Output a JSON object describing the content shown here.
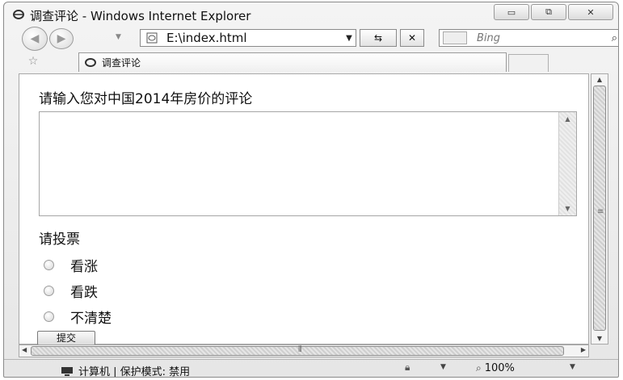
{
  "window": {
    "title": "调查评论 - Windows Internet Explorer",
    "controls": {
      "minimize": "▭",
      "restore": "⧉",
      "close": "✕"
    }
  },
  "navigation": {
    "address": "E:\\index.html",
    "search_placeholder": "Bing"
  },
  "tab": {
    "title": "调查评论"
  },
  "page": {
    "prompt": "请输入您对中国2014年房价的评论",
    "comment_value": "",
    "vote_label": "请投票",
    "options": [
      {
        "label": "看涨",
        "checked": false
      },
      {
        "label": "看跌",
        "checked": false
      },
      {
        "label": "不清楚",
        "checked": false
      }
    ],
    "submit_label": "提交"
  },
  "statusbar": {
    "zone": "计算机 | 保护模式: 禁用",
    "zoom": "100%"
  }
}
